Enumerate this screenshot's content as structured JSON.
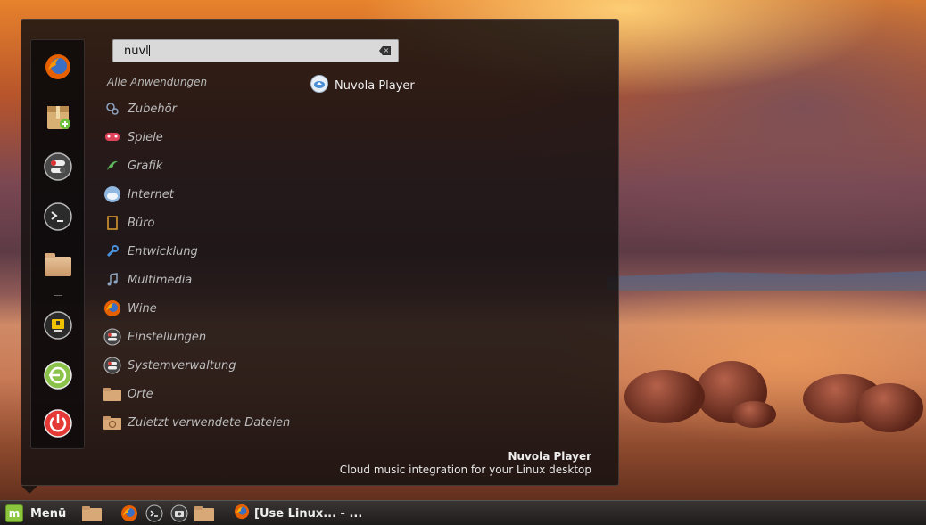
{
  "search": {
    "value": "nuvl"
  },
  "categories": {
    "header": "Alle Anwendungen",
    "items": [
      {
        "label": "Zubehör"
      },
      {
        "label": "Spiele"
      },
      {
        "label": "Grafik"
      },
      {
        "label": "Internet"
      },
      {
        "label": "Büro"
      },
      {
        "label": "Entwicklung"
      },
      {
        "label": "Multimedia"
      },
      {
        "label": "Wine"
      },
      {
        "label": "Einstellungen"
      },
      {
        "label": "Systemverwaltung"
      },
      {
        "label": "Orte"
      },
      {
        "label": "Zuletzt verwendete  Dateien"
      }
    ]
  },
  "results": [
    {
      "label": "Nuvola Player"
    }
  ],
  "description": {
    "title": "Nuvola Player",
    "text": "Cloud music integration for your Linux desktop"
  },
  "taskbar": {
    "menu_label": "Menü",
    "window_label": "[Use Linux... - ..."
  },
  "icons": {
    "favorites": [
      "firefox-icon",
      "software-manager-icon",
      "system-settings-icon",
      "terminal-icon",
      "files-icon",
      "lock-screen-icon",
      "logout-icon",
      "shutdown-icon"
    ],
    "categories": [
      "accessories-icon",
      "games-icon",
      "graphics-icon",
      "internet-icon",
      "office-icon",
      "development-icon",
      "multimedia-icon",
      "wine-icon",
      "settings-icon",
      "administration-icon",
      "places-icon",
      "recent-files-icon"
    ]
  },
  "colors": {
    "accent_green": "#8cc63f",
    "shutdown_red": "#e53935",
    "logout_green": "#8bc34a"
  }
}
